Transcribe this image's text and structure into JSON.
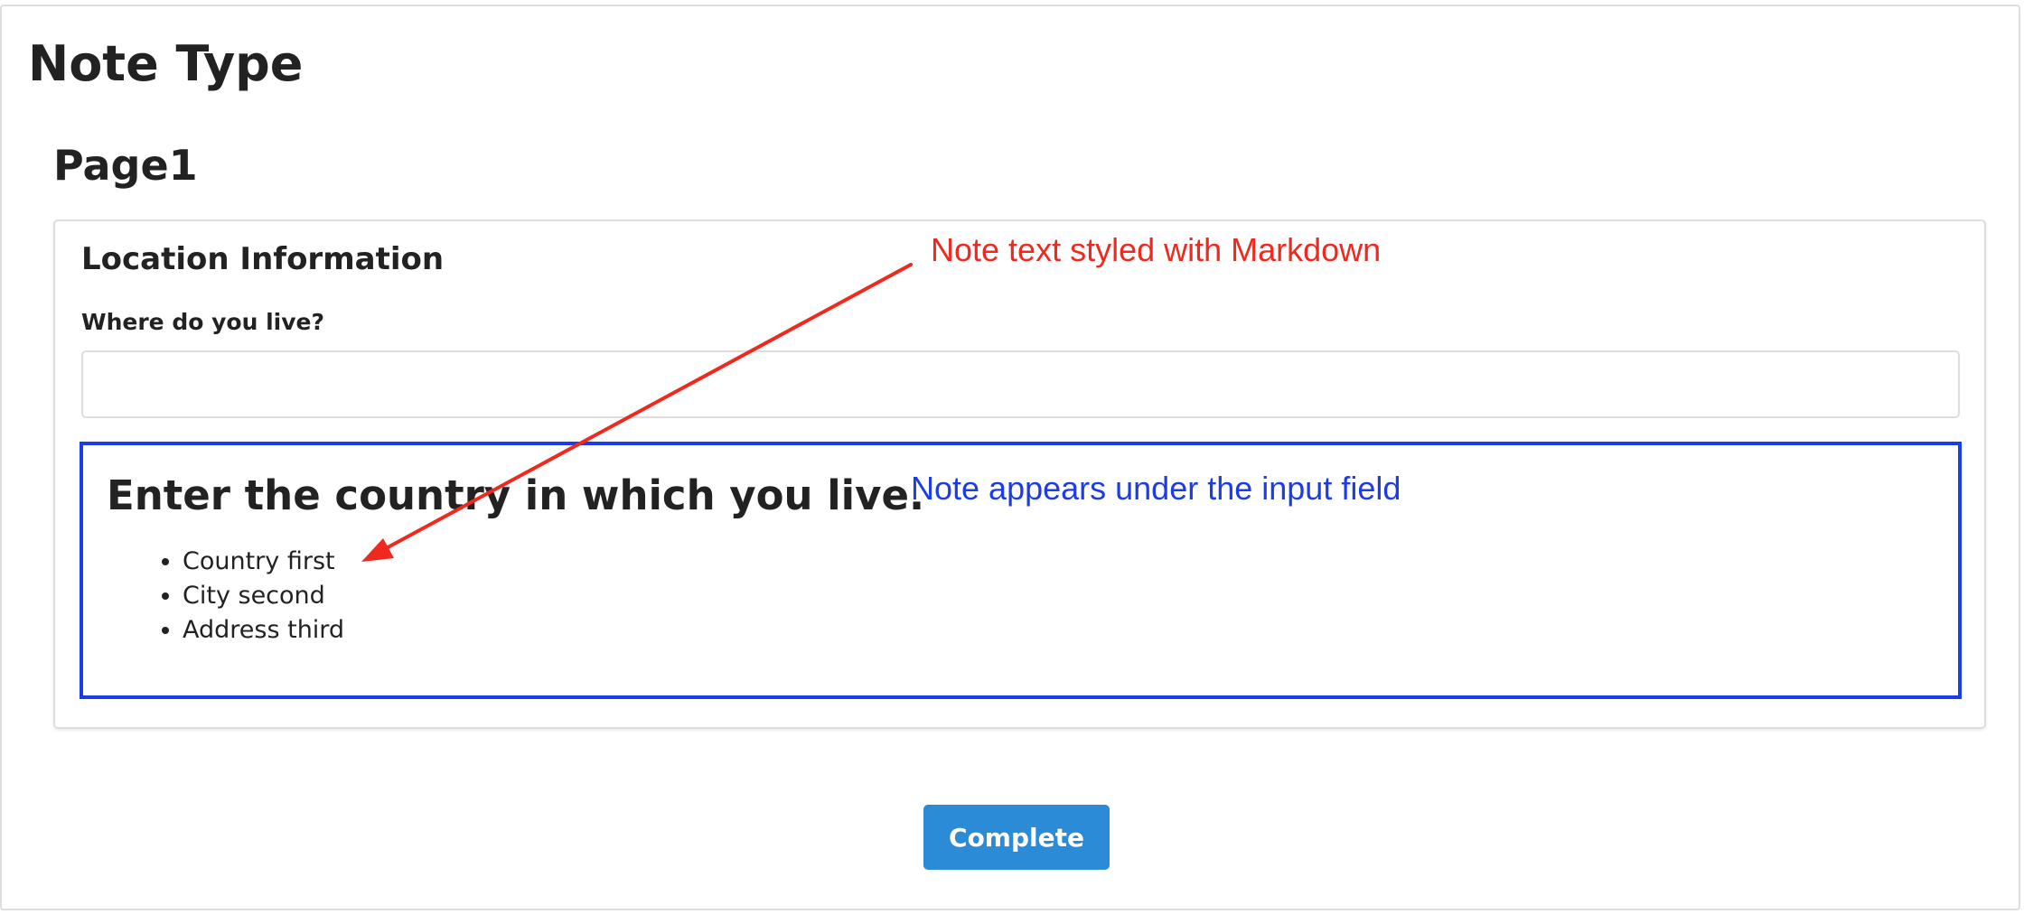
{
  "survey": {
    "title": "Note Type"
  },
  "page": {
    "title": "Page1"
  },
  "panel": {
    "title": "Location Information",
    "question": {
      "title": "Where do you live?",
      "value": "",
      "placeholder": ""
    },
    "note": {
      "heading": "Enter the country in which you live.",
      "items": [
        "Country first",
        "City second",
        "Address third"
      ]
    }
  },
  "buttons": {
    "complete_label": "Complete"
  },
  "annotations": {
    "markdown_note": "Note text styled with Markdown",
    "position_note": "Note appears under the input field"
  },
  "colors": {
    "annotation_red": "#f0291f",
    "annotation_blue": "#1b3ce6",
    "button_blue": "#2b8bd6"
  }
}
